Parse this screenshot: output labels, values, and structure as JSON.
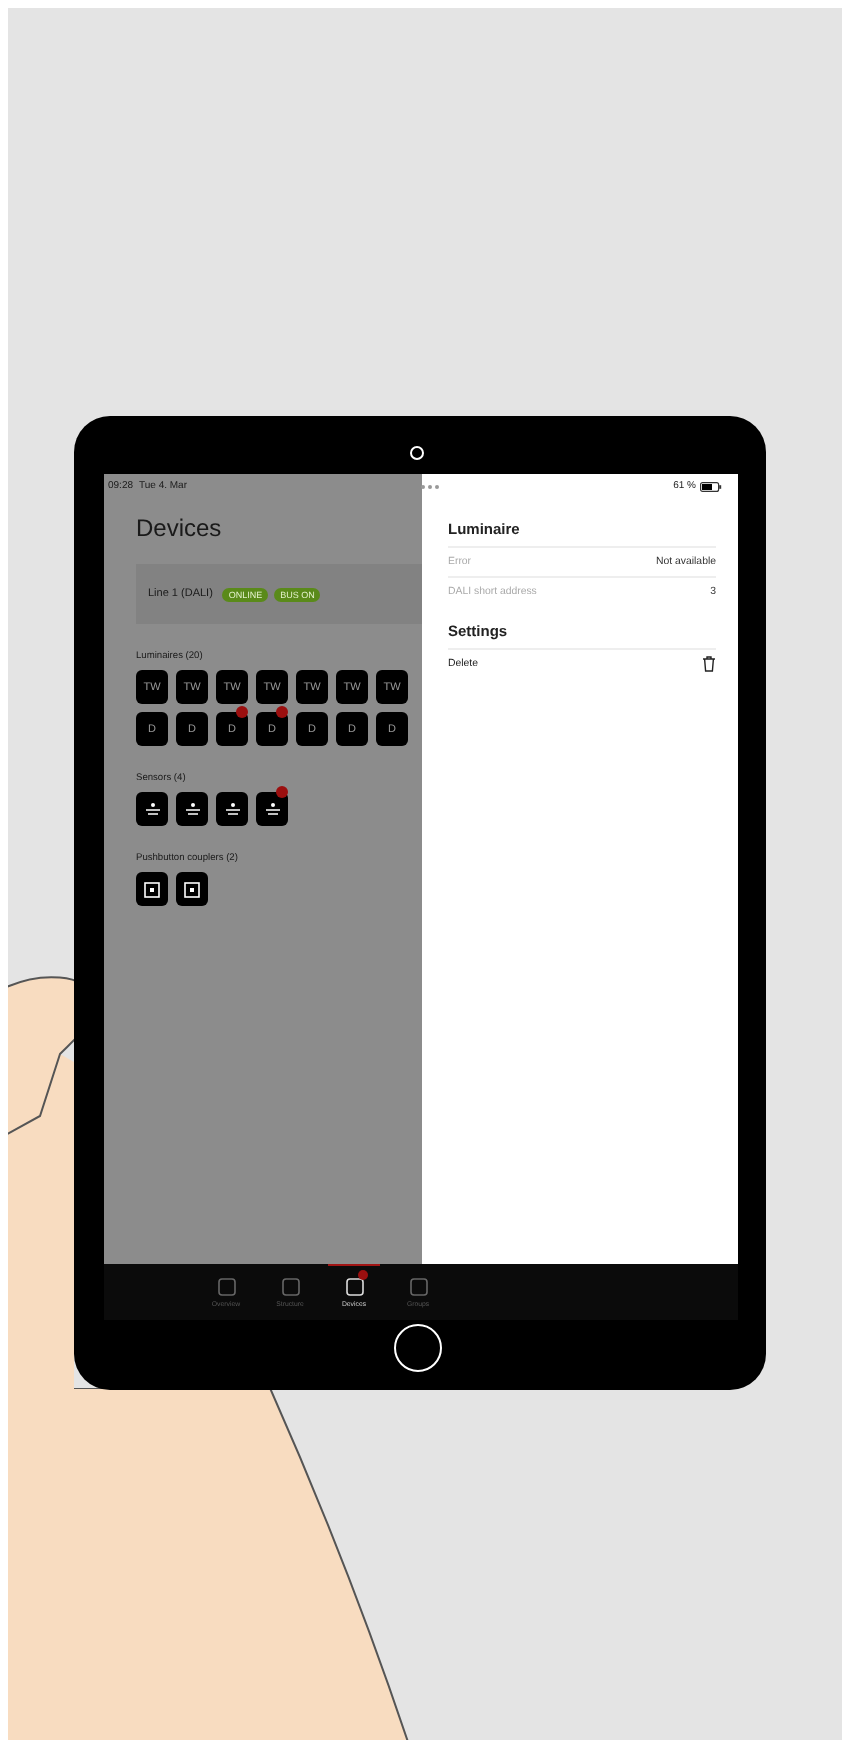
{
  "status_bar": {
    "time": "09:28",
    "date": "Tue 4. Mar",
    "battery": "61 %"
  },
  "devices": {
    "title": "Devices",
    "line": {
      "name": "Line 1 (DALI)",
      "badges": [
        "ONLINE",
        "BUS ON"
      ]
    },
    "luminaires": {
      "heading": "Luminaires (20)",
      "items": [
        {
          "label": "TW",
          "alert": false
        },
        {
          "label": "TW",
          "alert": false
        },
        {
          "label": "TW",
          "alert": false
        },
        {
          "label": "TW",
          "alert": false
        },
        {
          "label": "TW",
          "alert": false
        },
        {
          "label": "TW",
          "alert": false
        },
        {
          "label": "TW",
          "alert": false
        },
        {
          "label": "D",
          "alert": false
        },
        {
          "label": "D",
          "alert": false
        },
        {
          "label": "D",
          "alert": true
        },
        {
          "label": "D",
          "alert": true
        },
        {
          "label": "D",
          "alert": false
        },
        {
          "label": "D",
          "alert": false
        },
        {
          "label": "D",
          "alert": false
        }
      ]
    },
    "sensors": {
      "heading": "Sensors (4)",
      "items": [
        {
          "alert": false
        },
        {
          "alert": false
        },
        {
          "alert": false
        },
        {
          "alert": true
        }
      ]
    },
    "couplers": {
      "heading": "Pushbutton couplers (2)",
      "items": [
        {
          "alert": false
        },
        {
          "alert": false
        }
      ]
    }
  },
  "tabs": [
    {
      "label": "Overview",
      "selected": false,
      "alert": false
    },
    {
      "label": "Structure",
      "selected": false,
      "alert": false
    },
    {
      "label": "Devices",
      "selected": true,
      "alert": true
    },
    {
      "label": "Groups",
      "selected": false,
      "alert": false
    }
  ],
  "sheet": {
    "title": "Luminaire",
    "rows": [
      {
        "label": "Error",
        "value": "Not available"
      },
      {
        "label": "DALI short address",
        "value": "3"
      }
    ],
    "settings_title": "Settings",
    "delete_label": "Delete"
  }
}
